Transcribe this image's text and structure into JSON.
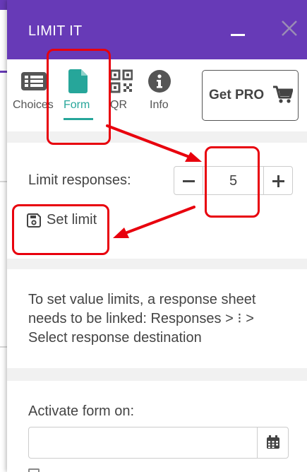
{
  "header": {
    "title": "LIMIT IT"
  },
  "tabs": [
    {
      "label": "Choices",
      "icon": "list-icon"
    },
    {
      "label": "Form",
      "icon": "file-icon",
      "active": true
    },
    {
      "label": "QR",
      "icon": "qr-code-icon"
    },
    {
      "label": "Info",
      "icon": "info-icon"
    }
  ],
  "pro_button": {
    "label": "Get PRO",
    "icon": "cart-icon"
  },
  "limit": {
    "label": "Limit responses:",
    "value": "5",
    "set_label": "Set limit"
  },
  "info": {
    "text": "To set value limits, a response sheet needs to be linked: Responses > ⁝ > Select response destination"
  },
  "activate": {
    "label": "Activate form on:",
    "placeholder": ""
  },
  "colors": {
    "header": "#673ab7",
    "accent": "#26a69a",
    "annotation": "#e8000d"
  }
}
